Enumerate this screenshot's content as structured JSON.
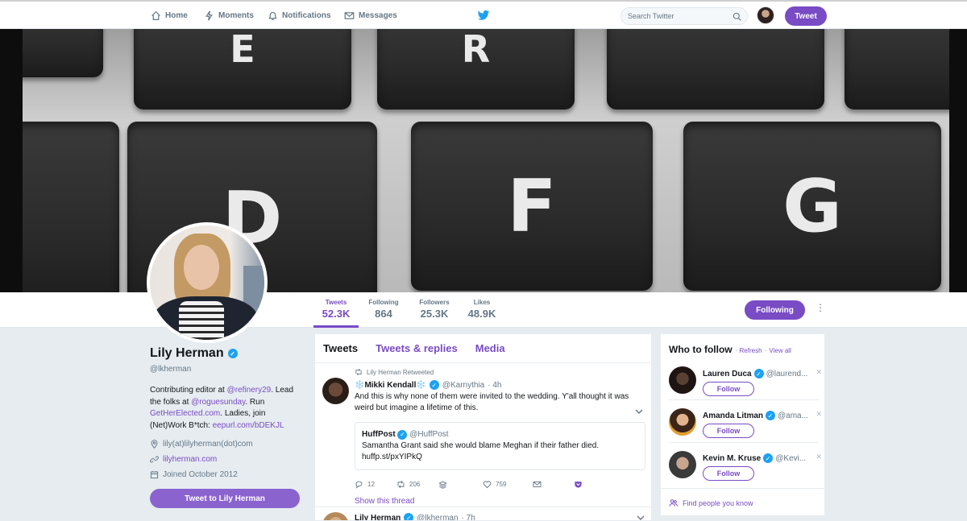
{
  "nav": {
    "home": "Home",
    "moments": "Moments",
    "notifications": "Notifications",
    "messages": "Messages",
    "search_placeholder": "Search Twitter",
    "tweet_button": "Tweet"
  },
  "banner": {
    "keys": [
      "E",
      "R",
      "D",
      "F",
      "G"
    ]
  },
  "stats": [
    {
      "label": "Tweets",
      "value": "52.3K"
    },
    {
      "label": "Following",
      "value": "864"
    },
    {
      "label": "Followers",
      "value": "25.3K"
    },
    {
      "label": "Likes",
      "value": "48.9K"
    }
  ],
  "following_button": "Following",
  "profile": {
    "name": "Lily Herman",
    "handle": "@lkherman",
    "bio": {
      "t1": "Contributing editor at ",
      "l1": "@refinery29",
      "t2": ". Lead the folks at ",
      "l2": "@roguesunday",
      "t3": ". Run ",
      "l3": "GetHerElected.com",
      "t4": ". Ladies, join (Net)Work B*tch: ",
      "l4": "eepurl.com/bDEKJL"
    },
    "location": "lily(at)lilyherman(dot)com",
    "website": "lilyherman.com",
    "joined": "Joined October 2012",
    "tweet_to": "Tweet to Lily Herman"
  },
  "timeline": {
    "tabs": [
      "Tweets",
      "Tweets & replies",
      "Media"
    ],
    "tweet1": {
      "retweeted_by": "Lily Herman Retweeted",
      "name": "❄️Mikki Kendall❄️",
      "handle": "@Karnythia",
      "time": "· 4h",
      "text": "And this is why none of them were invited to the wedding. Y'all thought it was weird but imagine a lifetime of this.",
      "quote_name": "HuffPost",
      "quote_handle": "@HuffPost",
      "quote_text": "Samantha Grant said she would blame Meghan if their father died. huffp.st/pxYIPkQ",
      "replies": "12",
      "retweets": "206",
      "likes": "759",
      "show_thread": "Show this thread"
    },
    "tweet2": {
      "name": "Lily Herman",
      "handle": "@lkherman",
      "time": "· 7h"
    }
  },
  "who_to_follow": {
    "title": "Who to follow",
    "refresh": "· Refresh",
    "view_all": "· View all",
    "suggestions": [
      {
        "name": "Lauren Duca",
        "handle": "@laurend..."
      },
      {
        "name": "Amanda Litman",
        "handle": "@ama..."
      },
      {
        "name": "Kevin M. Kruse",
        "handle": "@Kevi..."
      }
    ],
    "follow_label": "Follow",
    "find_people": "Find people you know"
  },
  "colors": {
    "accent": "#794bc4",
    "verified": "#1da1f2",
    "background": "#e6ecf0"
  }
}
